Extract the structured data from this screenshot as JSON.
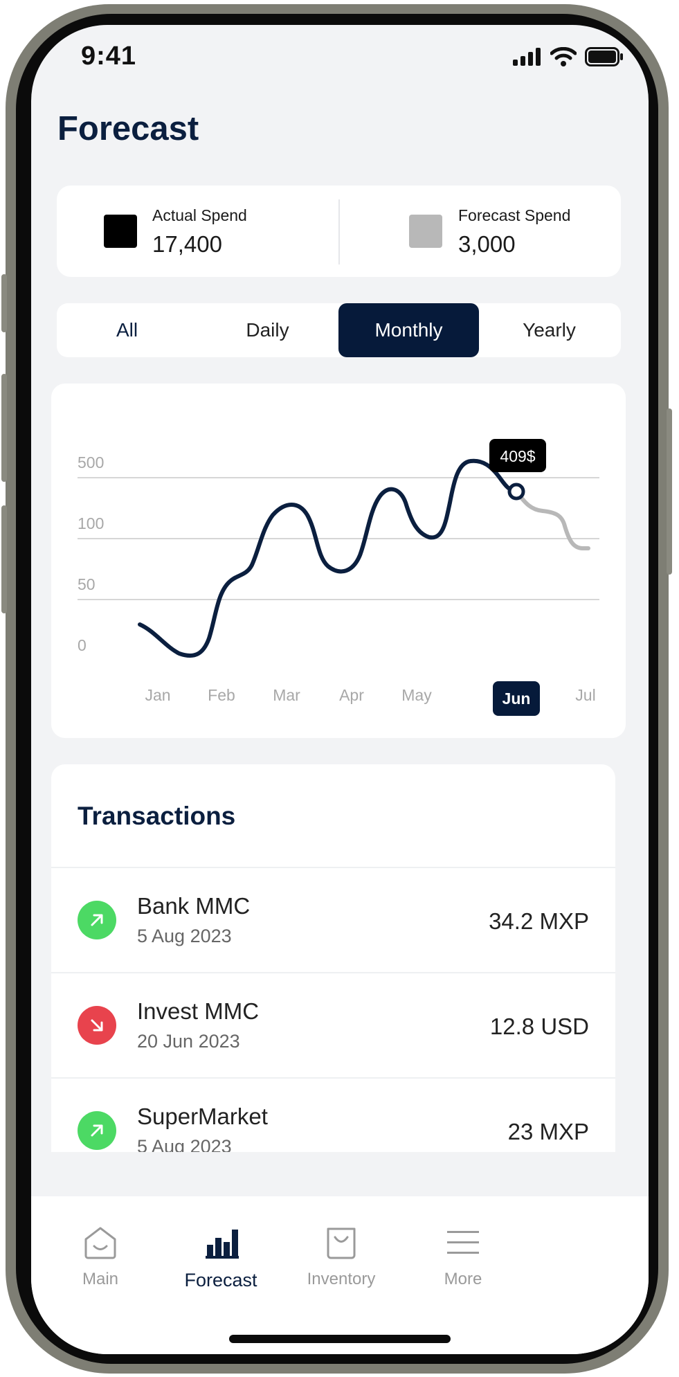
{
  "status_bar": {
    "time": "9:41"
  },
  "header": {
    "title": "Forecast"
  },
  "summary": {
    "actual": {
      "label": "Actual Spend",
      "value": "17,400",
      "color": "#000000"
    },
    "forecast": {
      "label": "Forecast Spend",
      "value": "3,000",
      "color": "#b8b8b8"
    }
  },
  "tabs": [
    {
      "label": "All"
    },
    {
      "label": "Daily"
    },
    {
      "label": "Monthly"
    },
    {
      "label": "Yearly"
    }
  ],
  "active_tab": "Monthly",
  "chart_data": {
    "type": "line",
    "x": [
      "Jan",
      "Feb",
      "Mar",
      "Apr",
      "May",
      "Jun",
      "Jul"
    ],
    "y_ticks": [
      "0",
      "50",
      "100",
      "500"
    ],
    "selected_x": "Jun",
    "tooltip": "409$",
    "series": [
      {
        "role": "actual",
        "color": "#0b1f3f"
      },
      {
        "role": "forecast",
        "color": "#b8b8b8"
      }
    ]
  },
  "transactions": {
    "title": "Transactions",
    "items": [
      {
        "name": "Bank MMC",
        "date": "5 Aug 2023",
        "amount": "34.2 MXP",
        "direction": "in",
        "color": "#4cd964",
        "icon": "arrow-up-right-icon"
      },
      {
        "name": "Invest MMC",
        "date": "20 Jun 2023",
        "amount": "12.8 USD",
        "direction": "out",
        "color": "#e8434d",
        "icon": "arrow-down-right-icon"
      },
      {
        "name": "SuperMarket",
        "date": "5 Aug 2023",
        "amount": "23 MXP",
        "direction": "in",
        "color": "#4cd964",
        "icon": "arrow-up-right-icon"
      }
    ]
  },
  "nav": [
    {
      "label": "Main",
      "icon": "home-icon"
    },
    {
      "label": "Forecast",
      "icon": "bar-chart-icon"
    },
    {
      "label": "Inventory",
      "icon": "bag-icon"
    },
    {
      "label": "More",
      "icon": "menu-icon"
    }
  ],
  "colors": {
    "accent": "#061a3a",
    "background": "#f2f3f5"
  }
}
